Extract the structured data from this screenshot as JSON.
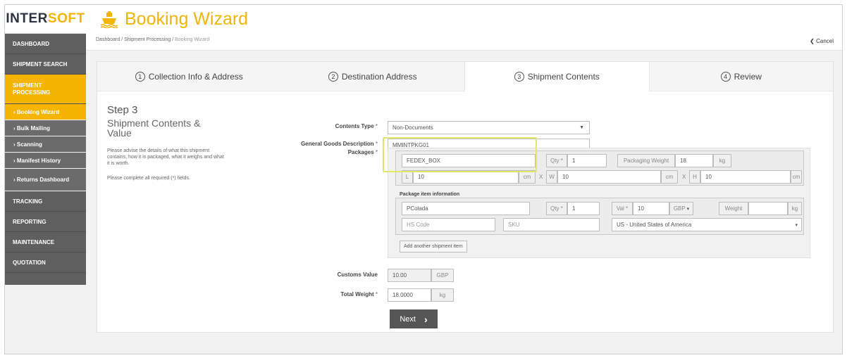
{
  "logo": {
    "part1": "INTER",
    "part2": "SOFT"
  },
  "sidebar": {
    "items": [
      {
        "label": "DASHBOARD"
      },
      {
        "label": "SHIPMENT SEARCH"
      },
      {
        "label": "SHIPMENT PROCESSING"
      },
      {
        "label": "TRACKING"
      },
      {
        "label": "REPORTING"
      },
      {
        "label": "MAINTENANCE"
      },
      {
        "label": "QUOTATION"
      }
    ],
    "subitems": [
      {
        "label": "› Booking Wizard"
      },
      {
        "label": "› Bulk Mailing"
      },
      {
        "label": "› Scanning"
      },
      {
        "label": "› Manifest History"
      },
      {
        "label": "› Returns Dashboard"
      }
    ]
  },
  "header": {
    "title": "Booking Wizard",
    "breadcrumb": [
      "Dashboard",
      "Shipment Processing",
      "Booking Wizard"
    ],
    "breadcrumb_sep": "/",
    "cancel_label": "Cancel"
  },
  "tabs": [
    {
      "num": "1",
      "label": "Collection Info & Address"
    },
    {
      "num": "2",
      "label": "Destination Address"
    },
    {
      "num": "3",
      "label": "Shipment Contents"
    },
    {
      "num": "4",
      "label": "Review"
    }
  ],
  "step": {
    "title": "Step 3",
    "subtitle": "Shipment Contents & Value",
    "description": "Please advise the details of what this shipment contains, how it is packaged, what it weighs and what it is worth.",
    "required_note": "Please complete all required (*) fields."
  },
  "form": {
    "contents_type_label": "Contents Type",
    "contents_type_value": "Non-Documents",
    "goods_desc_label": "General Goods Description",
    "goods_desc_value": "MMINTPKG01",
    "packages_label": "Packages",
    "required_mark": "*",
    "package": {
      "type": "FEDEX_BOX",
      "qty_label": "Qty",
      "qty": "1",
      "pkg_weight_label": "Packaging Weight",
      "pkg_weight": "18",
      "weight_unit": "kg",
      "l_label": "L",
      "l_value": "10",
      "w_label": "W",
      "w_value": "10",
      "h_label": "H",
      "h_value": "10",
      "dim_unit": "cm",
      "x_sep": "X"
    },
    "item_section_title": "Package item information",
    "item": {
      "name": "PColada",
      "qty_label": "Qty",
      "qty": "1",
      "val_label": "Val",
      "val": "10",
      "currency": "GBP",
      "weight_placeholder": "Weight",
      "weight_unit": "kg",
      "hs_placeholder": "HS Code",
      "sku_placeholder": "SKU",
      "country": "US - United States of America"
    },
    "add_item_label": "Add another shipment item",
    "customs_label": "Customs Value",
    "customs_value": "10.00",
    "customs_currency": "GBP",
    "total_weight_label": "Total Weight",
    "total_weight_value": "18.0000",
    "total_weight_unit": "kg",
    "next_label": "Next"
  },
  "colors": {
    "accent": "#f4b400",
    "sidebar": "#5f5f5f",
    "highlight": "#e2e865"
  }
}
